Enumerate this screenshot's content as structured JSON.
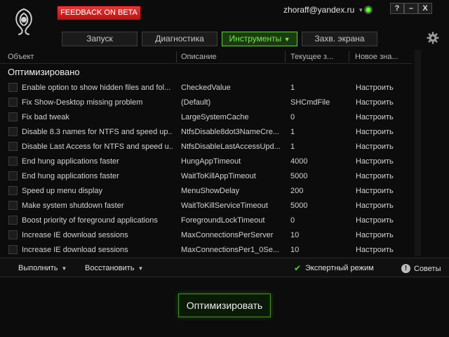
{
  "header": {
    "feedback_label": "FEEDBACK ON BETA",
    "account_email": "zhoraff@yandex.ru",
    "window_buttons": [
      "?",
      "–",
      "X"
    ],
    "status_color": "#5cf03a"
  },
  "tabs": [
    {
      "label": "Запуск",
      "active": false
    },
    {
      "label": "Диагностика",
      "active": false
    },
    {
      "label": "Инструменты",
      "active": true
    },
    {
      "label": "Захв. экрана",
      "active": false
    }
  ],
  "columns": [
    "Объект",
    "Описание",
    "Текущее з...",
    "Новое зна..."
  ],
  "section_title": "Оптимизировано",
  "rows": [
    {
      "object": "Enable option to show hidden files and fol...",
      "description": "CheckedValue",
      "current": "1",
      "new": "Настроить"
    },
    {
      "object": "Fix Show-Desktop missing problem",
      "description": "(Default)",
      "current": "SHCmdFile",
      "new": "Настроить"
    },
    {
      "object": "Fix bad tweak",
      "description": "LargeSystemCache",
      "current": "0",
      "new": "Настроить"
    },
    {
      "object": "Disable 8.3 names for NTFS and speed up...",
      "description": "NtfsDisable8dot3NameCre...",
      "current": "1",
      "new": "Настроить"
    },
    {
      "object": "Disable Last Access for NTFS and speed u...",
      "description": "NtfsDisableLastAccessUpd...",
      "current": "1",
      "new": "Настроить"
    },
    {
      "object": "End hung applications faster",
      "description": "HungAppTimeout",
      "current": "4000",
      "new": "Настроить"
    },
    {
      "object": "End hung applications faster",
      "description": "WaitToKillAppTimeout",
      "current": "5000",
      "new": "Настроить"
    },
    {
      "object": "Speed up menu display",
      "description": "MenuShowDelay",
      "current": "200",
      "new": "Настроить"
    },
    {
      "object": "Make system shutdown faster",
      "description": "WaitToKillServiceTimeout",
      "current": "5000",
      "new": "Настроить"
    },
    {
      "object": "Boost priority of foreground applications",
      "description": "ForegroundLockTimeout",
      "current": "0",
      "new": "Настроить"
    },
    {
      "object": "Increase IE download sessions",
      "description": "MaxConnectionsPerServer",
      "current": "10",
      "new": "Настроить"
    },
    {
      "object": "Increase IE download sessions",
      "description": "MaxConnectionsPer1_0Se...",
      "current": "10",
      "new": "Настроить"
    }
  ],
  "toolbar": {
    "execute_label": "Выполнить",
    "restore_label": "Восстановить",
    "expert_mode_label": "Экспертный режим",
    "tips_label": "Советы"
  },
  "optimize_label": "Оптимизировать",
  "colors": {
    "accent": "#58d82c",
    "feedback": "#c81e1e"
  }
}
